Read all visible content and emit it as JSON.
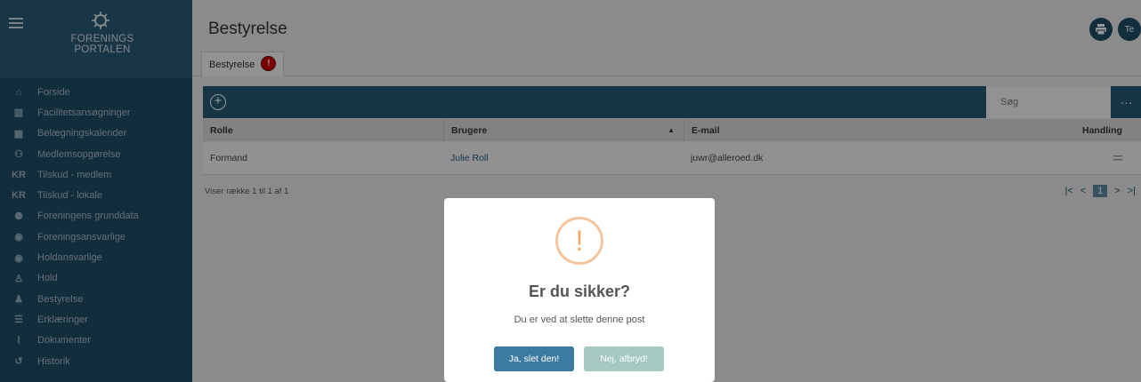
{
  "sidebar": {
    "logo_line1": "FORENINGS",
    "logo_line2": "PORTALEN",
    "items": [
      {
        "label": "Forside",
        "icon": "home-icon",
        "glyph": "⌂"
      },
      {
        "label": "Facilitetsansøgninger",
        "icon": "building-icon",
        "glyph": "▥"
      },
      {
        "label": "Belægningskalender",
        "icon": "calendar-icon",
        "glyph": "▦"
      },
      {
        "label": "Medlemsopgørelse",
        "icon": "add-user-icon",
        "glyph": "⚇"
      },
      {
        "label": "Tilskud - medlem",
        "icon": "kr-icon",
        "glyph": "KR"
      },
      {
        "label": "Tilskud - lokale",
        "icon": "kr-icon",
        "glyph": "KR"
      },
      {
        "label": "Foreningens grunddata",
        "icon": "group-icon",
        "glyph": "⚉"
      },
      {
        "label": "Foreningsansvarlige",
        "icon": "account-circle-icon",
        "glyph": "◉"
      },
      {
        "label": "Holdansvarlige",
        "icon": "account-circle-icon",
        "glyph": "◉"
      },
      {
        "label": "Hold",
        "icon": "team-icon",
        "glyph": "♙"
      },
      {
        "label": "Bestyrelse",
        "icon": "board-icon",
        "glyph": "♟"
      },
      {
        "label": "Erklæringer",
        "icon": "checklist-icon",
        "glyph": "☰"
      },
      {
        "label": "Dokumenter",
        "icon": "paperclip-icon",
        "glyph": "⌇"
      },
      {
        "label": "Historik",
        "icon": "history-icon",
        "glyph": "↺"
      }
    ]
  },
  "header": {
    "title": "Bestyrelse",
    "print_icon": "print-icon",
    "avatar_initials": "Te"
  },
  "tabs": [
    {
      "label": "Bestyrelse",
      "badge": "!"
    }
  ],
  "toolbar": {
    "add_icon": "add-circle-icon",
    "search_placeholder": "Søg",
    "more_label": "···"
  },
  "table": {
    "headers": {
      "rolle": "Rolle",
      "brugere": "Brugere",
      "sort_indicator": "▲",
      "email": "E-mail",
      "handling": "Handling"
    },
    "rows": [
      {
        "rolle": "Formand",
        "brugere": "Julie Roll",
        "email": "juwr@alleroed.dk",
        "action_icon": "menu-icon"
      }
    ],
    "info": "Viser række 1 til 1 af 1"
  },
  "pager": {
    "first": "|<",
    "prev": "<",
    "current": "1",
    "next": ">",
    "last": ">|"
  },
  "modal": {
    "icon": "!",
    "title": "Er du sikker?",
    "text": "Du er ved at slette denne post",
    "confirm": "Ja, slet den!",
    "cancel": "Nej, afbryd!"
  },
  "colors": {
    "sidebar": "#1f4b63",
    "toolbar": "#275a74",
    "confirm": "#3d7aa1",
    "cancel": "#a5c8c3",
    "warning": "#f3a96a",
    "badge": "#cc0000"
  }
}
